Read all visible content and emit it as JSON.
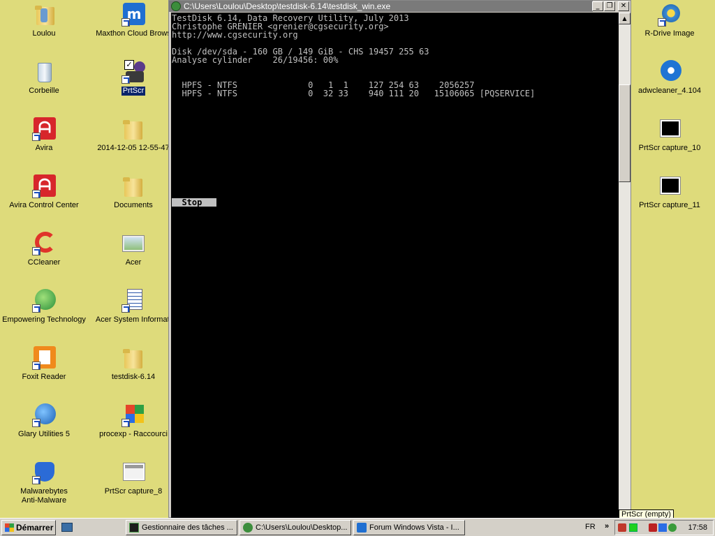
{
  "desktop": {
    "left_icons": [
      {
        "label": "Loulou",
        "icon": "user-folder-icon"
      },
      {
        "label": "Corbeille",
        "icon": "recycle-bin-icon"
      },
      {
        "label": "Avira",
        "icon": "avira-icon"
      },
      {
        "label": "Avira Control Center",
        "icon": "avira-control-center-icon"
      },
      {
        "label": "CCleaner",
        "icon": "ccleaner-icon"
      },
      {
        "label": "Empowering Technology",
        "icon": "empowering-technology-icon"
      },
      {
        "label": "Foxit Reader",
        "icon": "foxit-reader-icon"
      },
      {
        "label": "Glary Utilities 5",
        "icon": "glary-utilities-icon"
      },
      {
        "label": "Malwarebytes\nAnti-Malware",
        "icon": "malwarebytes-icon"
      }
    ],
    "mid_icons": [
      {
        "label": "Maxthon Cloud Brows",
        "icon": "maxthon-icon"
      },
      {
        "label": "PrtScr",
        "icon": "prtscr-icon",
        "selected": true
      },
      {
        "label": "2014-12-05 12-55-47",
        "icon": "folder-icon"
      },
      {
        "label": "Documents",
        "icon": "folder-icon"
      },
      {
        "label": "Acer",
        "icon": "acer-image-icon"
      },
      {
        "label": "Acer System Informati",
        "icon": "document-icon"
      },
      {
        "label": "testdisk-6.14",
        "icon": "folder-icon"
      },
      {
        "label": "procexp - Raccourci",
        "icon": "procexp-icon"
      },
      {
        "label": "PrtScr capture_8",
        "icon": "capture-image-icon"
      }
    ],
    "right_icons": [
      {
        "label": "R-Drive Image",
        "icon": "r-drive-image-icon"
      },
      {
        "label": "adwcleaner_4.104",
        "icon": "adwcleaner-icon"
      },
      {
        "label": "PrtScr capture_10",
        "icon": "capture-black-icon"
      },
      {
        "label": "PrtScr capture_11",
        "icon": "capture-black-icon"
      }
    ]
  },
  "console": {
    "title": "C:\\Users\\Loulou\\Desktop\\testdisk-6.14\\testdisk_win.exe",
    "buttons": {
      "minimize": "_",
      "restore": "❐",
      "close": "✕"
    },
    "lines": [
      "TestDisk 6.14, Data Recovery Utility, July 2013",
      "Christophe GRENIER <grenier@cgsecurity.org>",
      "http://www.cgsecurity.org",
      "",
      "Disk /dev/sda - 160 GB / 149 GiB - CHS 19457 255 63",
      "Analyse cylinder    26/19456: 00%",
      "",
      "",
      "  HPFS - NTFS              0   1  1    127 254 63    2056257",
      "  HPFS - NTFS              0  32 33    940 111 20   15106065 [PQSERVICE]"
    ],
    "stop_label": "  Stop  "
  },
  "taskbar": {
    "start_label": "Démarrer",
    "tasks": [
      {
        "label": "Gestionnaire des tâches ...",
        "icon": "task-manager-icon"
      },
      {
        "label": "C:\\Users\\Loulou\\Desktop...",
        "icon": "console-icon"
      },
      {
        "label": "Forum Windows Vista - I...",
        "icon": "maxthon-icon"
      }
    ],
    "language": "FR",
    "chevron": "»",
    "clock": "17:58",
    "tooltip": "PrtScr (empty)"
  },
  "colors": {
    "desktop": "#dedb7b",
    "terminal_bg": "#000000",
    "terminal_fg": "#c0c0c0",
    "selection": "#0a246a"
  }
}
